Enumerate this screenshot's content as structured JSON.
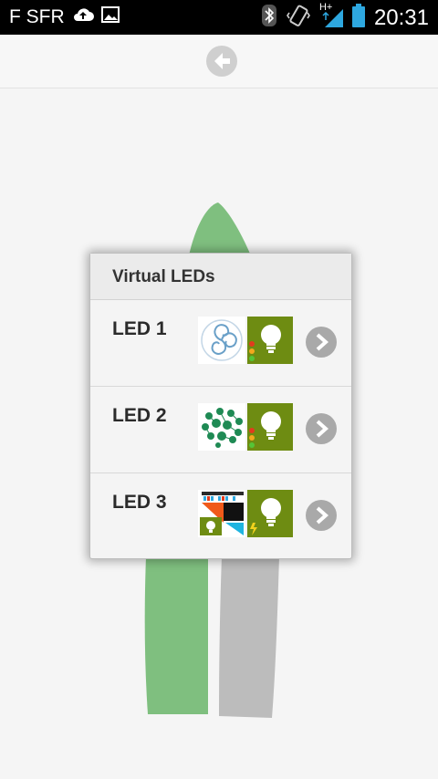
{
  "status_bar": {
    "carrier": "F SFR",
    "network": "H+",
    "time": "20:31"
  },
  "dialog": {
    "title": "Virtual LEDs",
    "items": [
      {
        "label": "LED 1"
      },
      {
        "label": "LED 2"
      },
      {
        "label": "LED 3"
      }
    ]
  },
  "colors": {
    "led_green": "#6e8c12",
    "leaf_green": "#7fbf7f",
    "grey_leg": "#bcbcbc",
    "chevron_grey": "#a9a9a9"
  }
}
